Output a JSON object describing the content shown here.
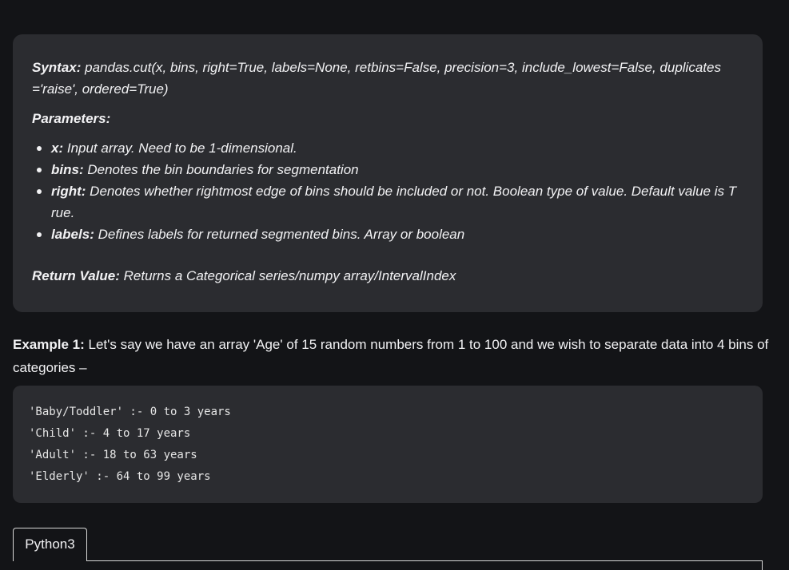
{
  "syntax_box": {
    "syntax_label": "Syntax:",
    "syntax_text_1": " pandas.cut(x, bins, right=True, labels=None, retbins=False, precision=3, include_lowest=False, duplicates",
    "syntax_text_2": "='raise', ordered=True)",
    "parameters_heading": "Parameters:",
    "params": [
      {
        "name": "x:",
        "desc_1": " Input array. Need to be 1-dimensional.",
        "desc_2": ""
      },
      {
        "name": "bins:",
        "desc_1": " Denotes the bin boundaries for segmentation",
        "desc_2": ""
      },
      {
        "name": "right:",
        "desc_1": " Denotes whether rightmost edge of bins should be included or not. Boolean type of value. Default value is T",
        "desc_2": "rue."
      },
      {
        "name": "labels:",
        "desc_1": " Defines labels for returned segmented bins. Array or boolean",
        "desc_2": ""
      }
    ],
    "return_label": "Return Value:",
    "return_text": " Returns a Categorical series/numpy array/IntervalIndex"
  },
  "example": {
    "label": "Example 1:",
    "text_1": " Let's say we have an array 'Age' of 15 random numbers from 1 to 100 and we wish to separate data into 4 bins of",
    "text_2": "categories –"
  },
  "code_lines": [
    "'Baby/Toddler' :- 0 to 3 years",
    "'Child' :- 4 to 17 years",
    "'Adult' :- 18 to 63 years",
    "'Elderly' :- 64 to 99 years"
  ],
  "tabs": {
    "python3_label": "Python3"
  }
}
